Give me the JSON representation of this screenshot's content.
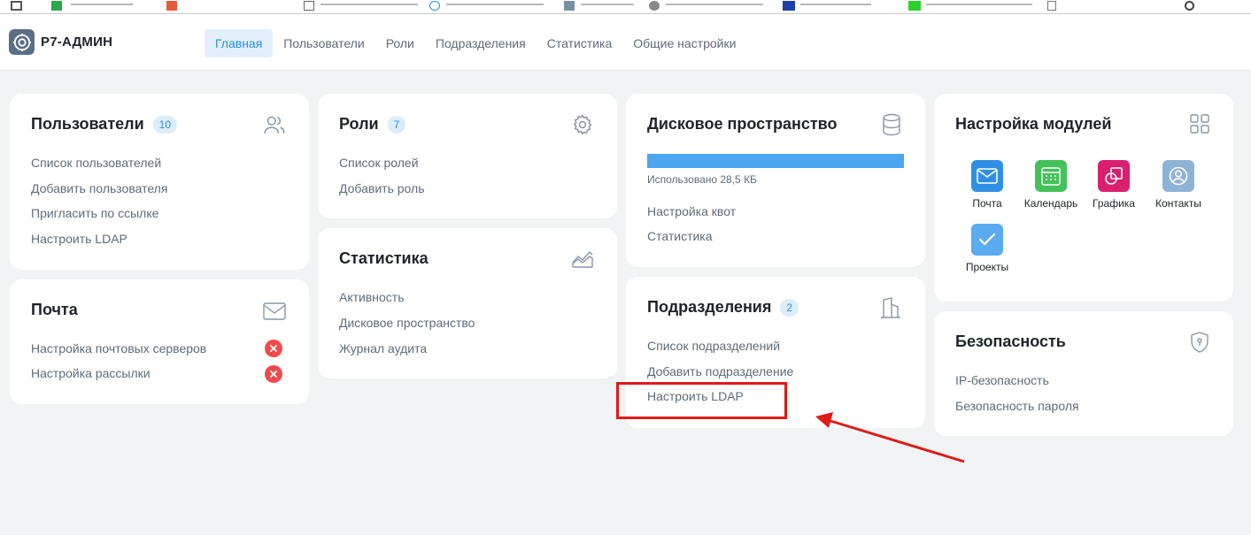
{
  "app": {
    "title": "Р7-АДМИН"
  },
  "colors": {
    "accent": "#2b8fe0",
    "error": "#ef4b4b",
    "annotation": "#e11a1a",
    "disk_fill": "#4da6f2"
  },
  "nav": {
    "items": [
      {
        "label": "Главная",
        "active": true
      },
      {
        "label": "Пользователи"
      },
      {
        "label": "Роли"
      },
      {
        "label": "Подразделения"
      },
      {
        "label": "Статистика"
      },
      {
        "label": "Общие настройки"
      }
    ]
  },
  "users": {
    "title": "Пользователи",
    "count": "10",
    "icon": "users-icon",
    "links": [
      "Список пользователей",
      "Добавить пользователя",
      "Пригласить по ссылке",
      "Настроить LDAP"
    ]
  },
  "mail": {
    "title": "Почта",
    "icon": "mail-icon",
    "links": [
      "Настройка почтовых серверов",
      "Настройка рассылки"
    ]
  },
  "roles": {
    "title": "Роли",
    "count": "7",
    "icon": "gear-icon",
    "links": [
      "Список ролей",
      "Добавить роль"
    ]
  },
  "stats": {
    "title": "Статистика",
    "icon": "chart-icon",
    "links": [
      "Активность",
      "Дисковое пространство",
      "Журнал аудита"
    ]
  },
  "disk": {
    "title": "Дисковое пространство",
    "icon": "database-icon",
    "used_fraction": 1.0,
    "used_label": "Использовано 28,5 КБ",
    "links": [
      "Настройка квот",
      "Статистика"
    ]
  },
  "departments": {
    "title": "Подразделения",
    "count": "2",
    "icon": "building-icon",
    "links": [
      "Список подразделений",
      "Добавить подразделение",
      "Настроить LDAP"
    ]
  },
  "modules": {
    "title": "Настройка модулей",
    "icon": "grid-icon",
    "items": [
      {
        "label": "Почта",
        "color": "#2f8fe6",
        "icon": "mail-module-icon"
      },
      {
        "label": "Календарь",
        "color": "#45c15a",
        "icon": "calendar-module-icon"
      },
      {
        "label": "Графика",
        "color": "#d9206f",
        "icon": "graphics-module-icon"
      },
      {
        "label": "Контакты",
        "color": "#8fb3d6",
        "icon": "contacts-module-icon"
      },
      {
        "label": "Проекты",
        "color": "#5aabf0",
        "icon": "projects-module-icon"
      }
    ]
  },
  "security": {
    "title": "Безопасность",
    "icon": "shield-icon",
    "links": [
      "IP-безопасность",
      "Безопасность пароля"
    ]
  }
}
